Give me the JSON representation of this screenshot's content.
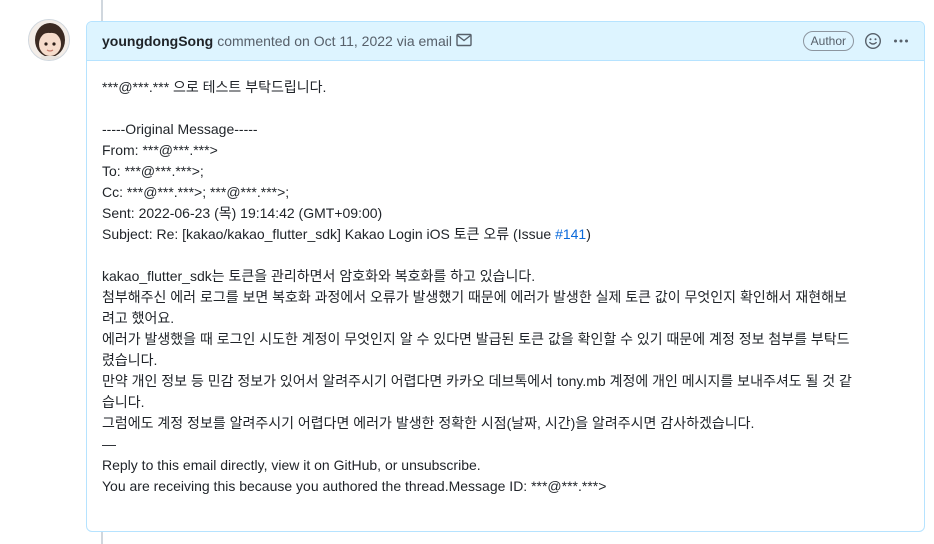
{
  "header": {
    "author": "youngdongSong",
    "action": "commented on Oct 11, 2022 via email",
    "badge": "Author",
    "emoji_icon": "smiley-icon",
    "more_icon": "kebab-horizontal-icon",
    "mail_icon": "mail-icon"
  },
  "body": {
    "line1": "***@***.*** 으로 테스트 부탁드립니다.",
    "original_header": "-----Original Message-----",
    "from": "From: ***@***.***>",
    "to": "To: ***@***.***>;",
    "cc": "Cc: ***@***.***>; ***@***.***>;",
    "sent": "Sent: 2022-06-23 (목) 19:14:42 (GMT+09:00)",
    "subject_prefix": "Subject: Re: [kakao/kakao_flutter_sdk] Kakao Login iOS 토큰 오류 (Issue ",
    "issue_link": "#141",
    "subject_suffix": ")",
    "p1": "kakao_flutter_sdk는 토큰을 관리하면서 암호화와 복호화를 하고 있습니다.",
    "p2a": "첨부해주신 에러 로그를 보면 복호화 과정에서 오류가 발생했기 때문에 에러가 발생한 실제 토큰 값이 무엇인지 확인해서 재현해보",
    "p2b": "려고 했어요.",
    "p3a": "에러가 발생했을 때 로그인 시도한 계정이 무엇인지 알 수 있다면 발급된 토큰 값을 확인할 수 있기 때문에 계정 정보 첨부를 부탁드",
    "p3b": "렸습니다.",
    "p4a": "만약 개인 정보 등 민감 정보가 있어서 알려주시기 어렵다면 카카오 데브톡에서 tony.mb 계정에 개인 메시지를 보내주셔도 될 것 같",
    "p4b": "습니다.",
    "p5": "그럼에도 계정 정보를 알려주시기 어렵다면 에러가 발생한 정확한 시점(날짜, 시간)을 알려주시면 감사하겠습니다.",
    "dash": "—",
    "reply": "Reply to this email directly, view it on GitHub, or unsubscribe.",
    "receiving": "You are receiving this because you authored the thread.Message ID: ***@***.***>"
  },
  "colors": {
    "header_bg": "#ddf4ff",
    "border": "#b6e3ff",
    "link": "#0969da"
  }
}
